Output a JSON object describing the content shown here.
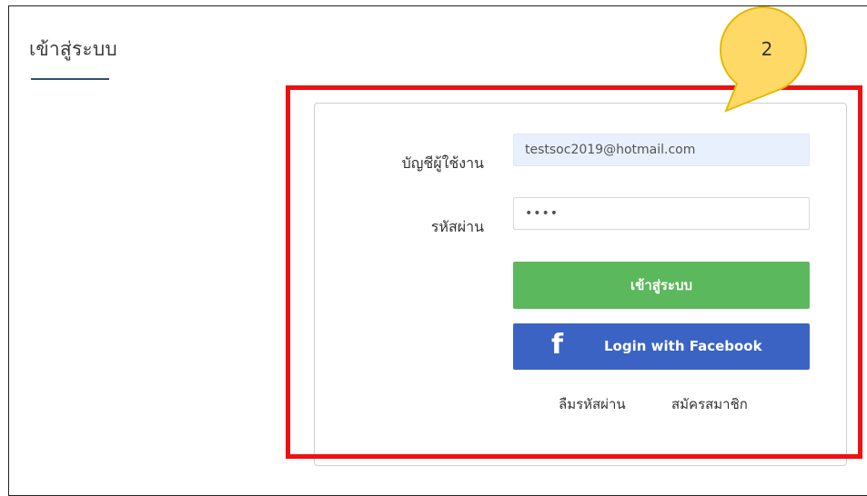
{
  "page": {
    "title": "เข้าสู่ระบบ"
  },
  "callout": {
    "number": "2",
    "fill_color": "#ffd966",
    "stroke_color": "#e6b800"
  },
  "highlight": {
    "color": "#ee1111"
  },
  "form": {
    "username_label": "บัญชีผู้ใช้งาน",
    "username_value": "testsoc2019@hotmail.com",
    "password_label": "รหัสผ่าน",
    "password_value": "••••",
    "login_button": "เข้าสู่ระบบ",
    "login_button_color": "#5cb85c",
    "facebook_icon": "facebook-f-icon",
    "facebook_button": "Login with Facebook",
    "facebook_button_color": "#3b63c4",
    "forgot_password": "ลืมรหัสผ่าน",
    "register": "สมัครสมาชิก"
  }
}
